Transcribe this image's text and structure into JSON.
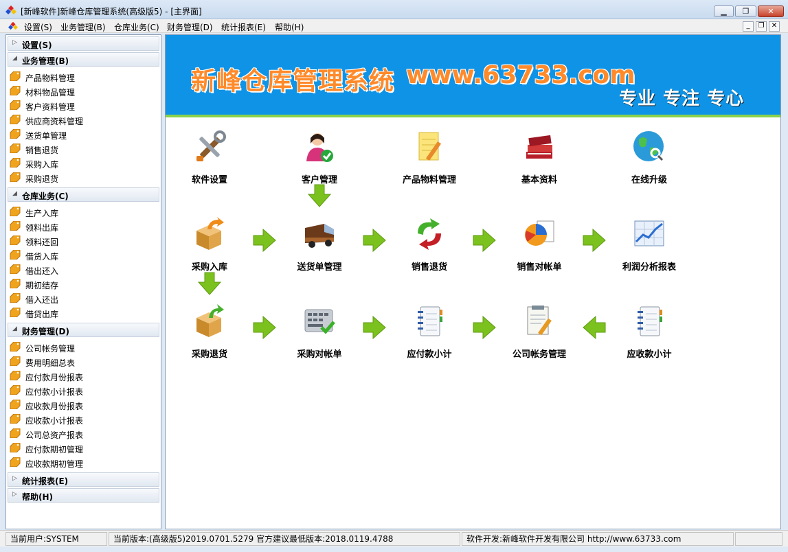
{
  "window": {
    "title": "[新峰软件]新峰仓库管理系统(高级版5) - [主界面]"
  },
  "menu": {
    "items": [
      "设置(S)",
      "业务管理(B)",
      "仓库业务(C)",
      "财务管理(D)",
      "统计报表(E)",
      "帮助(H)"
    ]
  },
  "sidebar": {
    "groups": [
      {
        "label": "设置(S)",
        "expanded": false,
        "items": []
      },
      {
        "label": "业务管理(B)",
        "expanded": true,
        "items": [
          "产品物料管理",
          "材料物品管理",
          "客户资料管理",
          "供应商资料管理",
          "送货单管理",
          "销售退货",
          "采购入库",
          "采购退货"
        ]
      },
      {
        "label": "仓库业务(C)",
        "expanded": true,
        "items": [
          "生产入库",
          "领料出库",
          "领料还回",
          "借货入库",
          "借出还入",
          "期初结存",
          "借入还出",
          "借贷出库"
        ]
      },
      {
        "label": "财务管理(D)",
        "expanded": true,
        "items": [
          "公司帐务管理",
          "费用明细总表",
          "应付款月份报表",
          "应付款小计报表",
          "应收款月份报表",
          "应收款小计报表",
          "公司总资产报表",
          "应付款期初管理",
          "应收款期初管理"
        ]
      },
      {
        "label": "统计报表(E)",
        "expanded": false,
        "items": []
      },
      {
        "label": "帮助(H)",
        "expanded": false,
        "items": []
      }
    ]
  },
  "banner": {
    "title": "新峰仓库管理系统",
    "url": "www.63733.com",
    "slogan": "专业 专注 专心",
    "bg_color": "#0f93e6",
    "text_color": "#ff8a2a"
  },
  "flow": {
    "row1": [
      {
        "label": "软件设置",
        "icon": "tools-icon"
      },
      {
        "label": "客户管理",
        "icon": "customer-icon"
      },
      {
        "label": "产品物料管理",
        "icon": "notepad-icon"
      },
      {
        "label": "基本资料",
        "icon": "books-icon"
      },
      {
        "label": "在线升级",
        "icon": "globe-icon"
      }
    ],
    "row2": [
      {
        "label": "采购入库",
        "icon": "box-in-icon"
      },
      {
        "label": "送货单管理",
        "icon": "truck-icon"
      },
      {
        "label": "销售退货",
        "icon": "return-arrows-icon"
      },
      {
        "label": "销售对帐单",
        "icon": "pie-chart-icon"
      },
      {
        "label": "利润分析报表",
        "icon": "line-chart-icon"
      }
    ],
    "row3": [
      {
        "label": "采购退货",
        "icon": "box-out-icon"
      },
      {
        "label": "采购对帐单",
        "icon": "keyboard-check-icon"
      },
      {
        "label": "应付款小计",
        "icon": "ledger-icon"
      },
      {
        "label": "公司帐务管理",
        "icon": "document-pen-icon"
      },
      {
        "label": "应收款小计",
        "icon": "ledger-icon"
      }
    ],
    "arrow_color": "#7cc21e"
  },
  "status": {
    "user": "当前用户:SYSTEM",
    "version": "当前版本:(高级版5)2019.0701.5279 官方建议最低版本:2018.0119.4788",
    "developer": "软件开发:新峰软件开发有限公司  http://www.63733.com"
  }
}
